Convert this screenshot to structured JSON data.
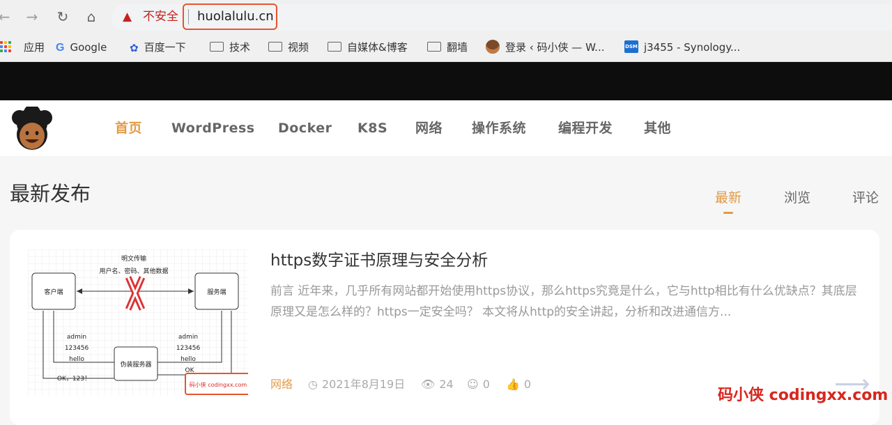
{
  "browser": {
    "security_label": "不安全",
    "url": "huolalulu.cn"
  },
  "bookmarks": [
    {
      "label": "应用",
      "icon": "apps-grid-icon"
    },
    {
      "label": "Google",
      "icon": "google-icon"
    },
    {
      "label": "百度一下",
      "icon": "baidu-paw-icon"
    },
    {
      "label": "技术",
      "icon": "folder-icon"
    },
    {
      "label": "视频",
      "icon": "folder-icon"
    },
    {
      "label": "自媒体&博客",
      "icon": "folder-icon"
    },
    {
      "label": "翻墙",
      "icon": "folder-icon"
    },
    {
      "label": "登录 ‹ 码小侠 — W...",
      "icon": "avatar-icon"
    },
    {
      "label": "j3455 - Synology...",
      "icon": "dsm-icon"
    }
  ],
  "dsm_badge": "DSM",
  "site": {
    "nav": [
      "首页",
      "WordPress",
      "Docker",
      "K8S",
      "网络",
      "操作系统",
      "编程开发",
      "其他"
    ],
    "section_title": "最新发布",
    "tabs": [
      "最新",
      "浏览",
      "评论"
    ]
  },
  "post": {
    "title": "https数字证书原理与安全分析",
    "excerpt": "前言 近年来，几乎所有网站都开始使用https协议，那么https究竟是什么，它与http相比有什么优缺点？其底层原理又是怎么样的？https一定安全吗？ 本文将从http的安全讲起，分析和改进通信方...",
    "category": "网络",
    "date": "2021年8月19日",
    "views": "24",
    "comments": "0",
    "likes": "0",
    "thumbnail": {
      "top_label_1": "明文传输",
      "top_label_2": "用户名、密码、其他数据",
      "client": "客户端",
      "server": "服务端",
      "proxy": "伪装服务器",
      "left_creds": [
        "admin",
        "123456",
        "hello"
      ],
      "right_creds": [
        "admin",
        "123456",
        "hello"
      ],
      "ok_left": "OK，123！",
      "ok_right": "OK",
      "stamp": "码小侠 codingxx.com"
    }
  },
  "watermark": "码小侠 codingxx.com",
  "colors": {
    "accent": "#e29a45",
    "warning": "#c5221f",
    "highlight_box": "#e8542e"
  }
}
